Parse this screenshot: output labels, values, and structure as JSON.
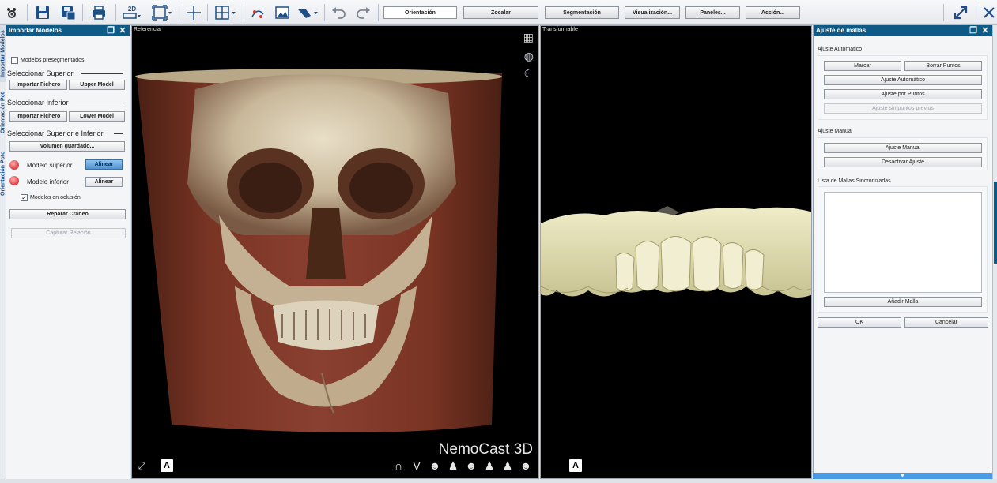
{
  "toolbar": {
    "icons": [
      "settings-icon",
      "save-icon",
      "save-as-icon",
      "print-icon",
      "2d-icon",
      "view-fit-icon",
      "crosshair-icon",
      "layout-grid-icon",
      "measure-icon",
      "image-icon",
      "tool-icon",
      "undo-icon",
      "redo-icon"
    ],
    "two_d_label": "2D",
    "buttons": {
      "orientacion": "Orientación",
      "zocalar": "Zocalar",
      "segmentacion": "Segmentación",
      "visualizacion": "Visualización...",
      "paneles": "Paneles...",
      "accion": "Acción..."
    }
  },
  "side_tabs": [
    "Importar Modelos",
    "Orientación Pot",
    "Orientación Poto"
  ],
  "left_panel": {
    "title": "Importar Modelos",
    "pre_segmented_label": "Modelos presegmentados",
    "pre_segmented_checked": false,
    "select_upper": {
      "title": "Seleccionar Superior",
      "import_button": "Importar Fichero",
      "model_button": "Upper Model"
    },
    "select_lower": {
      "title": "Seleccionar Inferior",
      "import_button": "Importar Fichero",
      "model_button": "Lower Model"
    },
    "select_both": {
      "title": "Seleccionar Superior e Inferior",
      "saved_volume_button": "Volumen guardado..."
    },
    "upper_model_label": "Modelo superior",
    "lower_model_label": "Modelo inferior",
    "align_label": "Alinear",
    "occlusion_label": "Modelos en oclusión",
    "occlusion_checked": true,
    "check_mark": "✓",
    "repair_skull_button": "Reparar Cráneo",
    "capture_relation_button": "Capturar Relación"
  },
  "viewport_reference": {
    "title": "Referencia",
    "orientation_badge": "A",
    "brand": "NemoCast 3D",
    "view_icons": [
      "∩",
      "V",
      "☻",
      "♟",
      "☻",
      "♟",
      "♟",
      "☻"
    ]
  },
  "viewport_transformable": {
    "title": "Transformable",
    "orientation_badge": "A"
  },
  "right_panel": {
    "title": "Ajuste de mallas",
    "auto_section": "Ajuste Automático",
    "mark_button": "Marcar",
    "clear_points_button": "Borrar Puntos",
    "auto_fit_button": "Ajuste Automático",
    "points_fit_button": "Ajuste por Puntos",
    "no_prior_points_button": "Ajuste sin puntos previos",
    "manual_section": "Ajuste Manual",
    "manual_fit_button": "Ajuste Manual",
    "deactivate_fit_button": "Desactivar Ajuste",
    "sync_list_label": "Lista de Mallas Sincronizadas",
    "add_mesh_button": "Añadir Malla",
    "ok_button": "OK",
    "cancel_button": "Cancelar"
  },
  "colors": {
    "header_blue": "#0d5a87",
    "icon_blue": "#1d4f86",
    "align_active": "#4f93d2",
    "led_red": "#e3474c"
  }
}
